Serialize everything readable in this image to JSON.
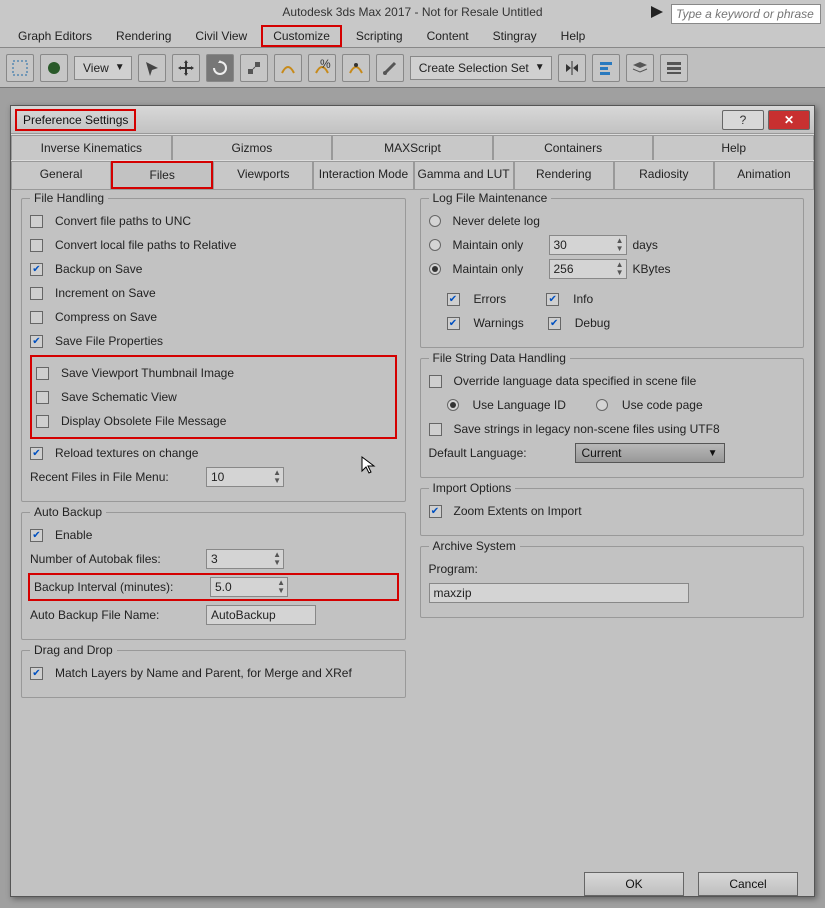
{
  "window": {
    "title": "Autodesk 3ds Max 2017 - Not for Resale    Untitled",
    "search_placeholder": "Type a keyword or phrase"
  },
  "menubar": [
    "Graph Editors",
    "Rendering",
    "Civil View",
    "Customize",
    "Scripting",
    "Content",
    "Stingray",
    "Help"
  ],
  "menubar_hl_index": 3,
  "toolbar": {
    "view_label": "View",
    "csset_label": "Create Selection Set"
  },
  "dialog": {
    "title": "Preference Settings",
    "tabs_row1": [
      "Inverse Kinematics",
      "Gizmos",
      "MAXScript",
      "Containers",
      "Help"
    ],
    "tabs_row2": [
      "General",
      "Files",
      "Viewports",
      "Interaction Mode",
      "Gamma and LUT",
      "Rendering",
      "Radiosity",
      "Animation"
    ],
    "active_tab": "Files",
    "ok": "OK",
    "cancel": "Cancel"
  },
  "file_handling": {
    "legend": "File Handling",
    "items": [
      {
        "label": "Convert file paths to UNC",
        "checked": false
      },
      {
        "label": "Convert local file paths to Relative",
        "checked": false
      },
      {
        "label": "Backup on Save",
        "checked": true
      },
      {
        "label": "Increment on Save",
        "checked": false
      },
      {
        "label": "Compress on Save",
        "checked": false
      },
      {
        "label": "Save File Properties",
        "checked": true
      }
    ],
    "hl_items": [
      {
        "label": "Save Viewport Thumbnail Image",
        "checked": false
      },
      {
        "label": "Save Schematic View",
        "checked": false
      },
      {
        "label": "Display Obsolete File Message",
        "checked": false
      }
    ],
    "reload": {
      "label": "Reload textures on change",
      "checked": true
    },
    "recent_label": "Recent Files in File Menu:",
    "recent_val": "10"
  },
  "auto_backup": {
    "legend": "Auto Backup",
    "enable": {
      "label": "Enable",
      "checked": true
    },
    "num_label": "Number of Autobak files:",
    "num_val": "3",
    "interval_label": "Backup Interval (minutes):",
    "interval_val": "5.0",
    "name_label": "Auto Backup File Name:",
    "name_val": "AutoBackup"
  },
  "drag_drop": {
    "legend": "Drag and Drop",
    "match": {
      "label": "Match Layers by Name and Parent, for Merge and XRef",
      "checked": true
    }
  },
  "log": {
    "legend": "Log File Maintenance",
    "never": "Never delete log",
    "maintain_days_label": "Maintain only",
    "days_val": "30",
    "days_unit": "days",
    "maintain_kb_label": "Maintain only",
    "kb_val": "256",
    "kb_unit": "KBytes",
    "checks": [
      {
        "label": "Errors",
        "checked": true
      },
      {
        "label": "Info",
        "checked": true
      },
      {
        "label": "Warnings",
        "checked": true
      },
      {
        "label": "Debug",
        "checked": true
      }
    ]
  },
  "file_string": {
    "legend": "File String Data Handling",
    "override": {
      "label": "Override language data specified in scene file",
      "checked": false
    },
    "lang_id": "Use Language ID",
    "code_page": "Use code page",
    "utf8": {
      "label": "Save strings in legacy non-scene files using UTF8",
      "checked": false
    },
    "def_lang_label": "Default Language:",
    "def_lang_val": "Current"
  },
  "import_opts": {
    "legend": "Import Options",
    "zoom": {
      "label": "Zoom Extents on Import",
      "checked": true
    }
  },
  "archive": {
    "legend": "Archive System",
    "prog_label": "Program:",
    "prog_val": "maxzip"
  }
}
